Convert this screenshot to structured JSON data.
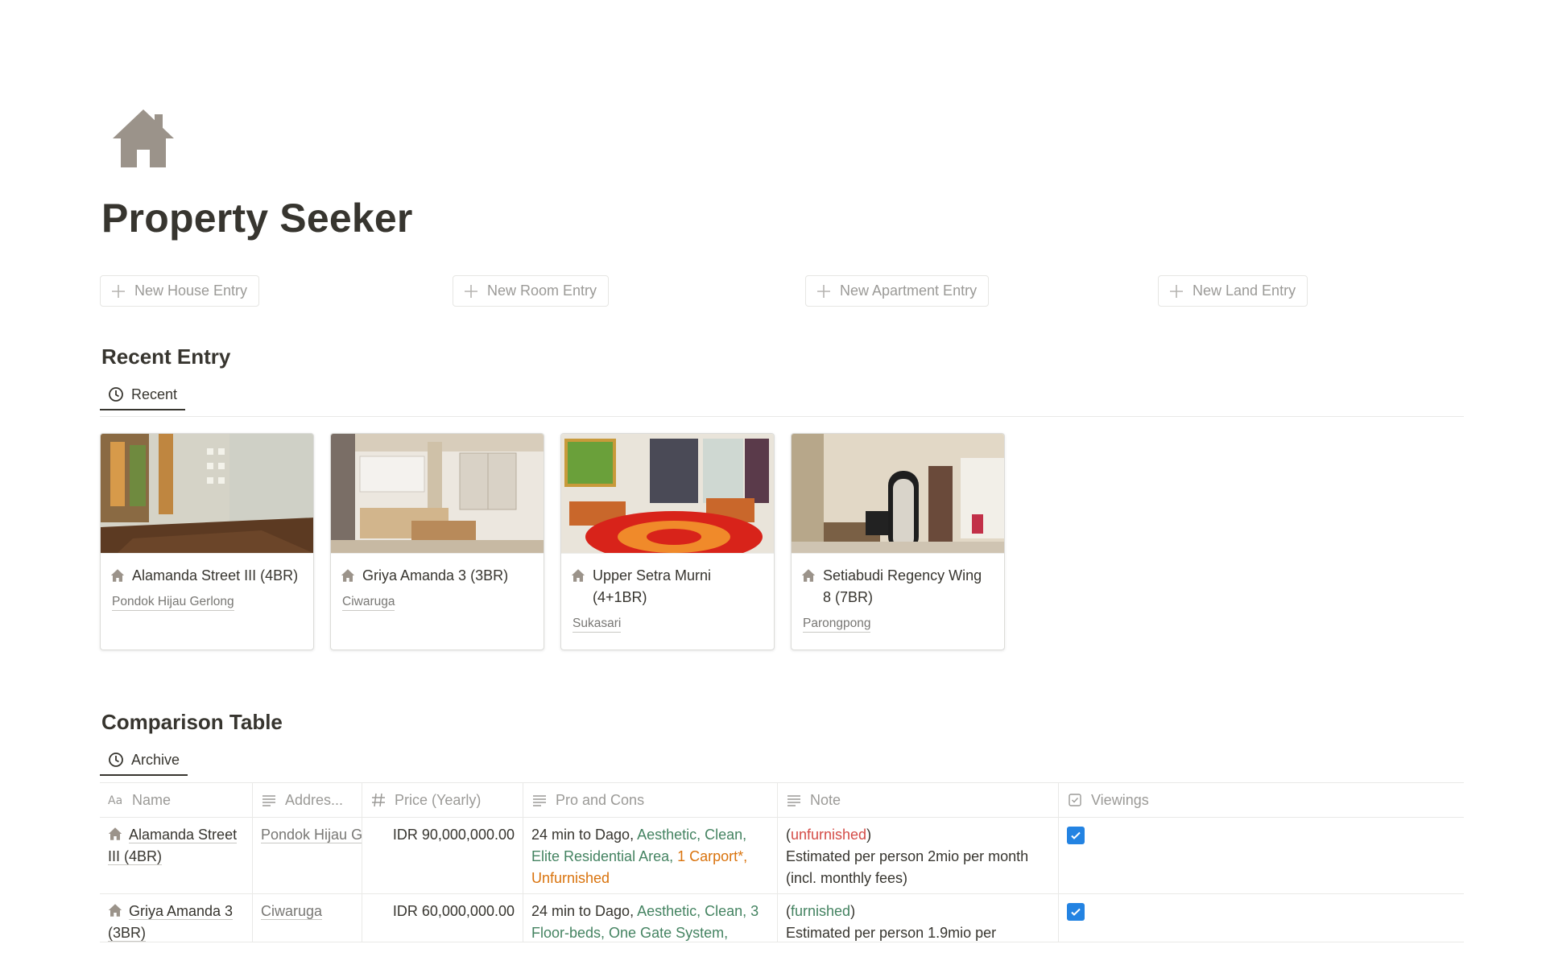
{
  "page": {
    "icon": "house-icon",
    "title": "Property Seeker"
  },
  "template_buttons": [
    {
      "label": "New House Entry"
    },
    {
      "label": "New Room Entry"
    },
    {
      "label": "New Apartment Entry"
    },
    {
      "label": "New Land Entry"
    }
  ],
  "recent": {
    "heading": "Recent Entry",
    "view_tab": "Recent",
    "cards": [
      {
        "title": "Alamanda Street III (4BR)",
        "location": "Pondok Hijau Gerlong"
      },
      {
        "title": "Griya Amanda 3 (3BR)",
        "location": "Ciwaruga"
      },
      {
        "title": "Upper Setra Murni (4+1BR)",
        "location": "Sukasari"
      },
      {
        "title": "Setiabudi Regency Wing 8 (7BR)",
        "location": "Parongpong"
      }
    ]
  },
  "comparison": {
    "heading": "Comparison Table",
    "view_tab": "Archive",
    "columns": {
      "name": "Name",
      "address": "Addres...",
      "price": "Price (Yearly)",
      "pros_cons": "Pro and Cons",
      "note": "Note",
      "viewings": "Viewings"
    },
    "rows": [
      {
        "name": "Alamanda Street III (4BR)",
        "address": "Pondok Hijau Gerlong",
        "price": "IDR 90,000,000.00",
        "pro_plain": "24 min to Dago, ",
        "pro_green": "Aesthetic, Clean, Elite Residential Area,",
        "pro_orange": "1 Carport*, Unfurnished",
        "note_status": "unfurnished",
        "note_text": "Estimated per person 2mio per month (incl. monthly fees)",
        "viewings": true
      },
      {
        "name": "Griya Amanda 3 (3BR)",
        "address": "Ciwaruga",
        "price": "IDR 60,000,000.00",
        "pro_plain": "24 min to Dago, ",
        "pro_green": "Aesthetic, Clean, 3 Floor-beds, One Gate System,",
        "pro_orange": "",
        "note_status": "furnished",
        "note_text": "Estimated per person 1.9mio per",
        "viewings": true
      }
    ]
  },
  "colors": {
    "text": "#37352f",
    "muted": "#9b9a97",
    "green": "#448361",
    "orange": "#d9730d",
    "red": "#d44c47",
    "checkbox": "#2383e2"
  }
}
